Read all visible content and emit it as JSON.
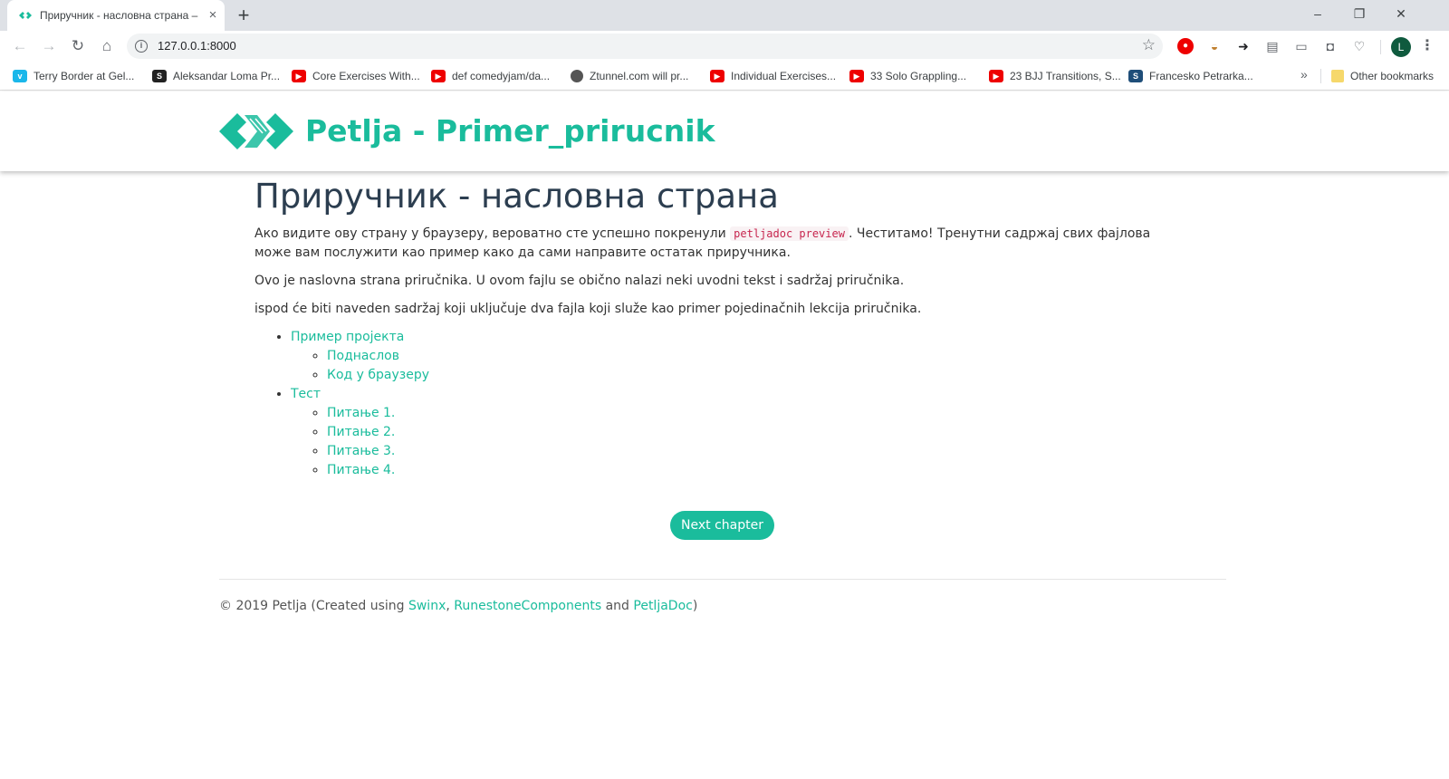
{
  "browser": {
    "tab_title": "Приручник - насловна страна – ",
    "tab_close": "×",
    "new_tab": "+",
    "window_minimize": "–",
    "window_restore": "❐",
    "window_close": "✕",
    "url": "127.0.0.1:8000",
    "profile_initial": "L",
    "bookmarks": [
      {
        "label": "Terry Border at Gel...",
        "icon": "vimeo-icon"
      },
      {
        "label": "Aleksandar Loma Pr...",
        "icon": "s-icon"
      },
      {
        "label": "Core Exercises With...",
        "icon": "youtube-icon"
      },
      {
        "label": "def comedyjam/da...",
        "icon": "youtube-icon"
      },
      {
        "label": "Ztunnel.com will pr...",
        "icon": "globe-icon"
      },
      {
        "label": "Individual Exercises...",
        "icon": "youtube-icon"
      },
      {
        "label": "33 Solo Grappling...",
        "icon": "youtube-icon"
      },
      {
        "label": "23 BJJ Transitions, S...",
        "icon": "youtube-icon"
      },
      {
        "label": "Francesko Petrarka...",
        "icon": "f-icon"
      }
    ],
    "bookmarks_more": "»",
    "other_bookmarks": "Other bookmarks"
  },
  "site": {
    "title": "Petlja - Primer_prirucnik",
    "brand_color": "#1abc9c"
  },
  "content": {
    "heading": "Приручник - насловна страна",
    "p1_before": "Ако видите ову страну у браузеру, вероватно сте успешно покренули ",
    "p1_code": "petljadoc preview",
    "p1_after": ". Честитамо! Тренутни садржај свих фајлова може вам послужити као пример како да сами направите остатак приручника.",
    "p2": "Ovo je naslovna strana priručnika. U ovom fajlu se obično nalazi neki uvodni tekst i sadržaj priručnika.",
    "p3": "ispod će biti naveden sadržaj koji uključuje dva fajla koji služe kao primer pojedinačnih lekcija priručnika.",
    "toc": [
      {
        "label": "Пример пројекта",
        "children": [
          "Поднаслов",
          "Код у браузеру"
        ]
      },
      {
        "label": "Тест",
        "children": [
          "Питање 1.",
          "Питање 2.",
          "Питање 3.",
          "Питање 4."
        ]
      }
    ]
  },
  "next_button": "Next chapter",
  "footer": {
    "prefix": "© 2019 Petlja (Created using ",
    "link1": "Swinx",
    "sep1": ", ",
    "link2": "RunestoneComponents",
    "sep2": " and ",
    "link3": "PetljaDoc",
    "suffix": ")"
  }
}
